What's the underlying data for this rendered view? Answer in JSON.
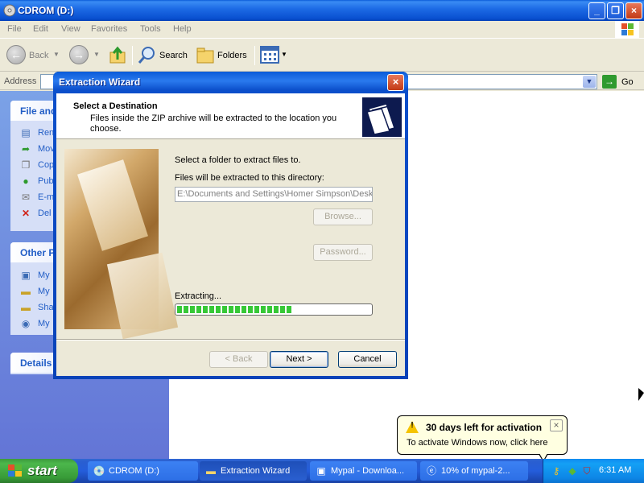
{
  "explorer": {
    "title": "CDROM (D:)",
    "menu": [
      "File",
      "Edit",
      "View",
      "Favorites",
      "Tools",
      "Help"
    ],
    "toolbar": {
      "back": "Back",
      "search": "Search",
      "folders": "Folders"
    },
    "address": {
      "label": "Address",
      "value": "",
      "go": "Go"
    },
    "panels": {
      "file_tasks": {
        "title": "File and",
        "items": [
          {
            "label": "Ren",
            "icon": "rename-icon"
          },
          {
            "label": "Mov",
            "icon": "move-icon"
          },
          {
            "label": "Cop",
            "icon": "copy-icon"
          },
          {
            "label": "Pub",
            "icon": "publish-globe-icon"
          },
          {
            "label": "E-m",
            "icon": "email-icon"
          },
          {
            "label": "Del",
            "icon": "delete-x-icon"
          }
        ]
      },
      "other_places": {
        "title": "Other P",
        "items": [
          {
            "label": "My",
            "icon": "my-computer-icon"
          },
          {
            "label": "My",
            "icon": "my-documents-icon"
          },
          {
            "label": "Sha",
            "icon": "shared-folder-icon"
          },
          {
            "label": "My",
            "icon": "my-network-icon"
          }
        ]
      },
      "details": {
        "title": "Details"
      }
    }
  },
  "dialog": {
    "title": "Extraction Wizard",
    "close": "×",
    "heading": "Select a Destination",
    "subheading": "Files inside the ZIP archive will be extracted to the location you choose.",
    "select_label": "Select a folder to extract files to.",
    "dir_label": "Files will be extracted to this directory:",
    "path": "E:\\Documents and Settings\\Homer Simpson\\Desk",
    "browse": "Browse...",
    "password": "Password...",
    "extracting": "Extracting...",
    "progress_fraction": 0.6,
    "back": "< Back",
    "next": "Next >",
    "cancel": "Cancel"
  },
  "balloon": {
    "title": "30 days left for activation",
    "text": "To activate Windows now, click here",
    "close": "×"
  },
  "taskbar": {
    "start": "start",
    "tasks": [
      {
        "label": "CDROM (D:)",
        "icon": "cdrom-icon",
        "active": false
      },
      {
        "label": "Extraction Wizard",
        "icon": "folder-icon",
        "active": true
      },
      {
        "label": "Mypal - Downloa...",
        "icon": "mypal-icon",
        "active": false
      },
      {
        "label": "10% of mypal-2...",
        "icon": "ie-icon",
        "active": false
      }
    ],
    "clock": "6:31 AM"
  },
  "colors": {
    "title_blue": "#0A5BD8",
    "taskbar_blue": "#245DDB",
    "start_green": "#379A37",
    "balloon_bg": "#FFFFE1",
    "progress_green": "#37C837"
  }
}
